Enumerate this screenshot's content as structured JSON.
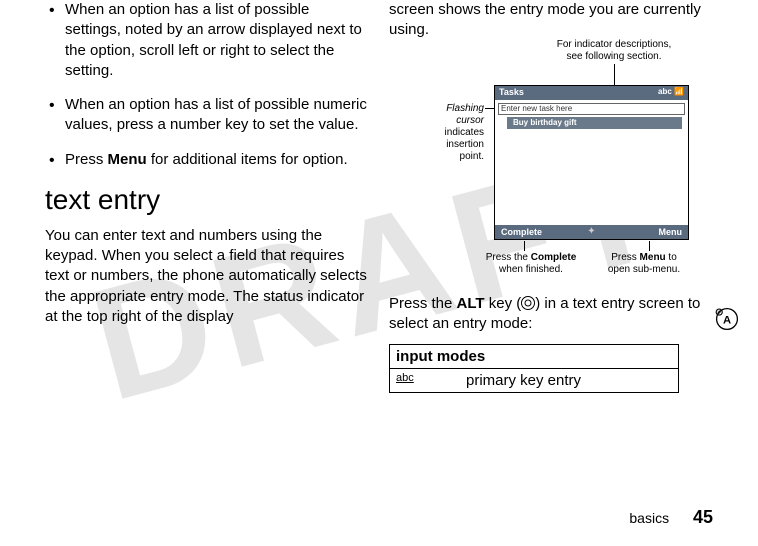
{
  "watermark": "DRAFT",
  "left": {
    "bullets": [
      {
        "pre": "When an option has a list of possible settings, noted by an arrow displayed next to the option, scroll left or right to select the setting."
      },
      {
        "pre": "When an option has a list of possible numeric values, press a number key to set the value."
      },
      {
        "pre_a": "Press ",
        "bold": "Menu",
        "post": " for additional items for option."
      }
    ],
    "heading": "text entry",
    "para": "You can enter text and numbers using the keypad. When you select a field that requires text or numbers, the phone automatically selects the appropriate entry mode. The status indicator at the top right of the display"
  },
  "right": {
    "top_cont": "screen shows the entry mode you are currently using.",
    "callouts": {
      "top_right_1": "For indicator descriptions,",
      "top_right_2": "see following section.",
      "left_em_1": "Flashing",
      "left_em_2": "cursor",
      "left_3": "indicates",
      "left_4": "insertion",
      "left_5": "point.",
      "bot_left_1a": "Press the ",
      "bot_left_1b": "Complete",
      "bot_left_2": "when finished.",
      "bot_right_1a": "Press ",
      "bot_right_1b": "Menu",
      "bot_right_1c": " to",
      "bot_right_2": "open sub-menu."
    },
    "screen": {
      "title": "Tasks",
      "indicator": "abc 📶",
      "entry_placeholder": "Enter new task here",
      "row1": "Buy birthday gift",
      "sk_left": "Complete",
      "sk_right": "Menu"
    },
    "alt_para_a": "Press the ",
    "alt_para_b": "ALT",
    "alt_para_c": " key (",
    "alt_para_d": ") in a text entry screen to select an entry mode:",
    "table": {
      "head": "input modes",
      "row1_c1": "abc",
      "row1_c2": "primary key entry"
    }
  },
  "footer": {
    "label": "basics",
    "page": "45"
  }
}
